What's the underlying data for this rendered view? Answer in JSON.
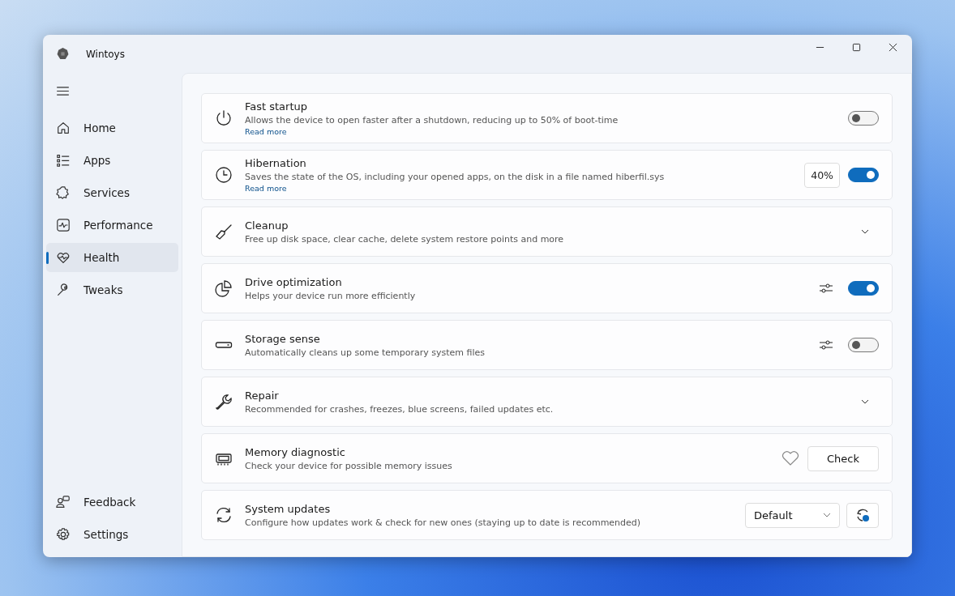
{
  "window": {
    "title": "Wintoys"
  },
  "sidebar": {
    "items": [
      {
        "label": "Home",
        "selected": false
      },
      {
        "label": "Apps",
        "selected": false
      },
      {
        "label": "Services",
        "selected": false
      },
      {
        "label": "Performance",
        "selected": false
      },
      {
        "label": "Health",
        "selected": true
      },
      {
        "label": "Tweaks",
        "selected": false
      }
    ],
    "footer_items": [
      {
        "label": "Feedback",
        "selected": false
      },
      {
        "label": "Settings",
        "selected": false
      }
    ]
  },
  "settings": [
    {
      "title": "Fast startup",
      "description": "Allows the device to open faster after a shutdown, reducing up to 50% of boot-time",
      "link": "Read more",
      "controls": [
        {
          "kind": "toggle",
          "on": false
        }
      ]
    },
    {
      "title": "Hibernation",
      "description": "Saves the state of the OS, including your opened apps, on the disk in a file named hiberfil.sys",
      "link": "Read more",
      "controls": [
        {
          "kind": "value",
          "text": "40%"
        },
        {
          "kind": "toggle",
          "on": true
        }
      ]
    },
    {
      "title": "Cleanup",
      "description": "Free up disk space, clear cache, delete system restore points and more",
      "controls": [
        {
          "kind": "expander",
          "expanded": false
        }
      ]
    },
    {
      "title": "Drive optimization",
      "description": "Helps your device run more efficiently",
      "controls": [
        {
          "kind": "options"
        },
        {
          "kind": "toggle",
          "on": true
        }
      ]
    },
    {
      "title": "Storage sense",
      "description": "Automatically cleans up some temporary system files",
      "controls": [
        {
          "kind": "options"
        },
        {
          "kind": "toggle",
          "on": false
        }
      ]
    },
    {
      "title": "Repair",
      "description": "Recommended for crashes, freezes, blue screens, failed updates etc.",
      "controls": [
        {
          "kind": "expander",
          "expanded": false
        }
      ]
    },
    {
      "title": "Memory diagnostic",
      "description": "Check your device for possible memory issues",
      "controls": [
        {
          "kind": "favorite"
        },
        {
          "kind": "button",
          "label": "Check"
        }
      ]
    },
    {
      "title": "System updates",
      "description": "Configure how updates work & check for new ones (staying up to date is recommended)",
      "controls": [
        {
          "kind": "select",
          "value": "Default"
        },
        {
          "kind": "refresh"
        }
      ]
    }
  ]
}
